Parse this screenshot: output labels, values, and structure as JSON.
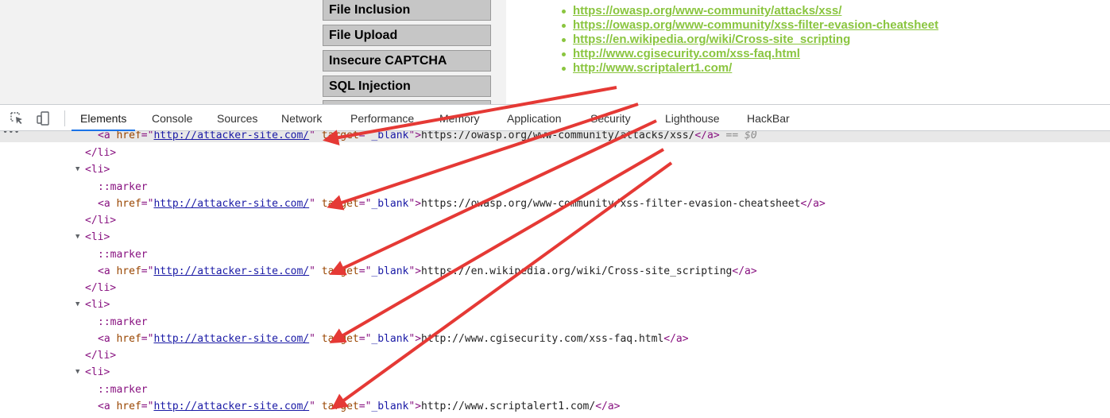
{
  "page": {
    "menu": [
      {
        "label": "File Inclusion"
      },
      {
        "label": "File Upload"
      },
      {
        "label": "Insecure CAPTCHA"
      },
      {
        "label": "SQL Injection"
      }
    ],
    "references": [
      "https://owasp.org/www-community/attacks/xss/",
      "https://owasp.org/www-community/xss-filter-evasion-cheatsheet",
      "https://en.wikipedia.org/wiki/Cross-site_scripting",
      "http://www.cgisecurity.com/xss-faq.html",
      "http://www.scriptalert1.com/"
    ],
    "link_color": "#8ac53f"
  },
  "devtools": {
    "tabs": [
      "Elements",
      "Console",
      "Sources",
      "Network",
      "Performance",
      "Memory",
      "Application",
      "Security",
      "Lighthouse",
      "HackBar"
    ],
    "active_tab": "Elements",
    "icons": [
      "inspect-element-icon",
      "device-toolbar-icon"
    ],
    "accent_color": "#1a73e8",
    "tree": {
      "open_a": "<a",
      "close_a": "</a>",
      "open_li": "<li>",
      "close_li": "</li>",
      "marker": "::marker",
      "attr_href": "href",
      "attr_target": "target",
      "href_value": "http://attacker-site.com/",
      "target_value": "_blank",
      "selected_suffix": "== $0",
      "anchors": [
        "https://owasp.org/www-community/attacks/xss/",
        "https://owasp.org/www-community/xss-filter-evasion-cheatsheet",
        "https://en.wikipedia.org/wiki/Cross-site_scripting",
        "http://www.cgisecurity.com/xss-faq.html",
        "http://www.scriptalert1.com/"
      ]
    }
  },
  "annotation": {
    "arrow_color": "#e53935",
    "arrow_count": 5
  }
}
